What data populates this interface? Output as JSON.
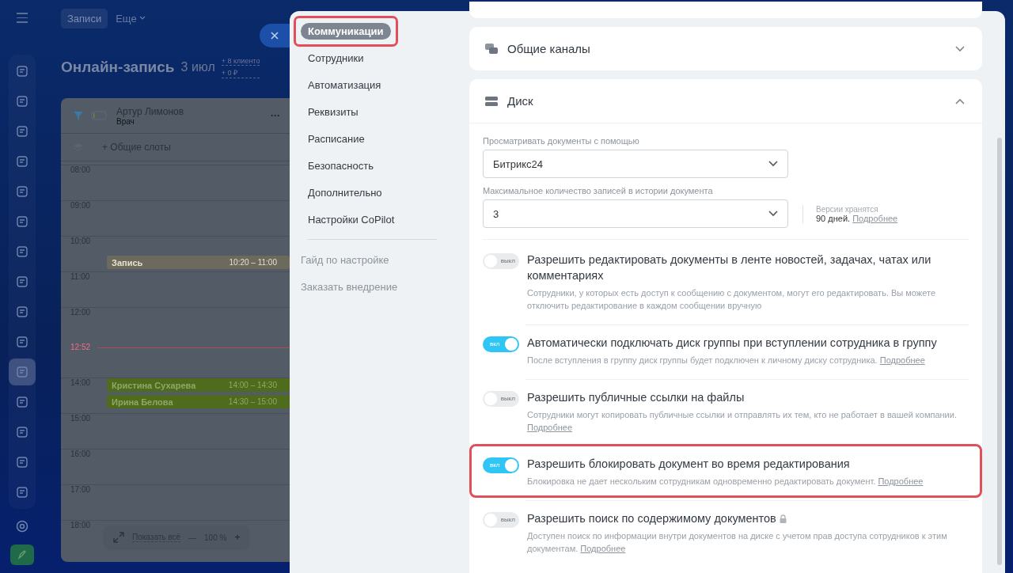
{
  "app": {
    "sidebar": [
      {
        "selected": false
      },
      {
        "selected": false
      },
      {
        "selected": false
      },
      {
        "selected": false
      },
      {
        "selected": false
      },
      {
        "selected": false
      },
      {
        "selected": false
      },
      {
        "selected": false
      },
      {
        "selected": false
      },
      {
        "selected": false
      },
      {
        "selected": true
      },
      {
        "selected": false
      },
      {
        "selected": false
      },
      {
        "selected": false
      },
      {
        "selected": false
      }
    ],
    "tabs": [
      {
        "label": "Записи",
        "selected": true
      }
    ],
    "more": "Еще",
    "title": "Онлайн-запись",
    "date": "3 июл",
    "stats": [
      "+ 8 клиенто",
      "+ 0 ₽"
    ],
    "resource": {
      "name": "Артур Лимонов",
      "role": "Врач",
      "menu": "···"
    },
    "shared_slots": "+ Общие слоты",
    "times": [
      {
        "label": "08:00",
        "kind": "hour"
      },
      {
        "label": "09:00",
        "kind": "hour"
      },
      {
        "label": "10:00",
        "kind": "hour",
        "events": [
          {
            "name": "Запись",
            "time": "10:20 – 11:00",
            "kind": "pending",
            "color": "#6b6a5c"
          }
        ]
      },
      {
        "label": "11:00",
        "kind": "hour"
      },
      {
        "label": "12:00",
        "kind": "hour"
      },
      {
        "label": "12:52",
        "kind": "now"
      },
      {
        "label": "14:00",
        "kind": "hour",
        "events": [
          {
            "name": "Кристина Сухарева",
            "time": "14:00 – 14:30",
            "kind": "confirmed",
            "color": "#4f6b1c"
          },
          {
            "name": "Ирина Белова",
            "time": "14:30 – 15:00",
            "kind": "confirmed",
            "color": "#4f6b1c"
          }
        ]
      },
      {
        "label": "15:00",
        "kind": "hour"
      },
      {
        "label": "16:00",
        "kind": "hour"
      },
      {
        "label": "17:00",
        "kind": "hour"
      },
      {
        "label": "18:00",
        "kind": "hour"
      }
    ],
    "toolbar": {
      "show_all": "Показать всё",
      "minus": "—",
      "zoom": "100 %",
      "plus": "+"
    }
  },
  "settings": {
    "nav": [
      {
        "label": "Коммуникации",
        "selected": true,
        "highlighted": true
      },
      {
        "label": "Сотрудники",
        "selected": false,
        "highlighted": false
      },
      {
        "label": "Автоматизация",
        "selected": false,
        "highlighted": false
      },
      {
        "label": "Реквизиты",
        "selected": false,
        "highlighted": false
      },
      {
        "label": "Расписание",
        "selected": false,
        "highlighted": false
      },
      {
        "label": "Безопасность",
        "selected": false,
        "highlighted": false
      },
      {
        "label": "Дополнительно",
        "selected": false,
        "highlighted": false
      },
      {
        "label": "Настройки CoPilot",
        "selected": false,
        "highlighted": false
      }
    ],
    "nav_secondary": [
      "Гайд по настройке",
      "Заказать внедрение"
    ],
    "sections": [
      {
        "title": "Общие каналы",
        "kind": "channels",
        "expanded": false
      },
      {
        "title": "Диск",
        "kind": "disk",
        "expanded": true,
        "selects": [
          {
            "label": "Просматривать документы с помощью",
            "value": "Битрикс24"
          },
          {
            "label": "Максимальное количество записей в истории документа",
            "value": "3",
            "note": "Версии хранятся",
            "note_value": "90 дней.",
            "note_link": "Подробнее"
          }
        ],
        "toggles": [
          {
            "title": "Разрешить редактировать документы в ленте новостей, задачах, чатах или комментариях",
            "description": "Сотрудники, у которых есть доступ к сообщению с документом, могут его редактировать. Вы можете отключить редактирование в каждом сообщении вручную",
            "switch_label": "выкл",
            "on": false,
            "locked": false,
            "highlighted": false
          },
          {
            "title": "Автоматически подключать диск группы при вступлении сотрудника в группу",
            "description": "После вступления в группу диск группы будет подключен к личному диску сотрудника.",
            "link": "Подробнее",
            "switch_label": "вкл",
            "on": true,
            "locked": false,
            "highlighted": false
          },
          {
            "title": "Разрешить публичные ссылки на файлы",
            "description": "Сотрудники могут копировать публичные ссылки и отправлять их тем, кто не работает в вашей компании.",
            "link": "Подробнее",
            "switch_label": "выкл",
            "on": false,
            "locked": false,
            "highlighted": false
          },
          {
            "title": "Разрешить блокировать документ во время редактирования",
            "description": "Блокировка не дает нескольким сотрудникам одновременно редактировать документ.",
            "link": "Подробнее",
            "switch_label": "вкл",
            "on": true,
            "locked": false,
            "highlighted": true
          },
          {
            "title": "Разрешить поиск по содержимому документов",
            "description": "Доступен поиск по информации внутри документов на диске с учетом прав доступа сотрудников к этим документам.",
            "link": "Подробнее",
            "switch_label": "выкл",
            "on": false,
            "locked": true,
            "highlighted": false
          }
        ]
      }
    ]
  }
}
